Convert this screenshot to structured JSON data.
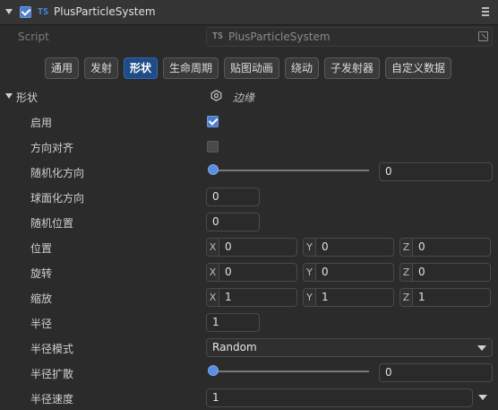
{
  "component": {
    "title": "PlusParticleSystem",
    "ts_badge": "TS",
    "enabled": true
  },
  "script_row": {
    "label": "Script",
    "value": "PlusParticleSystem",
    "ts_badge": "TS"
  },
  "tabs": [
    {
      "label": "通用",
      "active": false
    },
    {
      "label": "发射",
      "active": false
    },
    {
      "label": "形状",
      "active": true
    },
    {
      "label": "生命周期",
      "active": false
    },
    {
      "label": "贴图动画",
      "active": false
    },
    {
      "label": "绕动",
      "active": false
    },
    {
      "label": "子发射器",
      "active": false
    },
    {
      "label": "自定义数据",
      "active": false
    }
  ],
  "section": {
    "title": "形状",
    "shape_name": "边缘"
  },
  "props": {
    "enable": {
      "label": "启用",
      "checked": true
    },
    "align": {
      "label": "方向对齐",
      "checked": false
    },
    "random_dir": {
      "label": "随机化方向",
      "value": "0",
      "slider": 0
    },
    "spherical_dir": {
      "label": "球面化方向",
      "value": "0"
    },
    "random_pos": {
      "label": "随机位置",
      "value": "0"
    },
    "position": {
      "label": "位置",
      "x": "0",
      "y": "0",
      "z": "0"
    },
    "rotation": {
      "label": "旋转",
      "x": "0",
      "y": "0",
      "z": "0"
    },
    "scale": {
      "label": "缩放",
      "x": "1",
      "y": "1",
      "z": "1"
    },
    "radius": {
      "label": "半径",
      "value": "1"
    },
    "radius_mode": {
      "label": "半径模式",
      "value": "Random"
    },
    "radius_spread": {
      "label": "半径扩散",
      "value": "0",
      "slider": 0
    },
    "radius_speed": {
      "label": "半径速度",
      "value": "1"
    }
  },
  "axes": {
    "x": "X",
    "y": "Y",
    "z": "Z"
  }
}
